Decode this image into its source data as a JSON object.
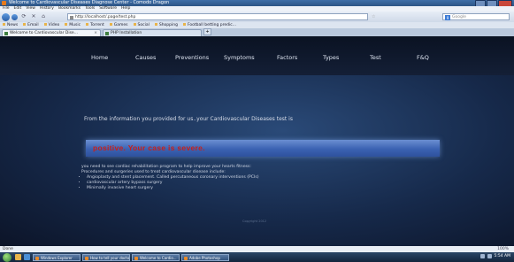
{
  "window": {
    "title": "Welcome to Cardiovascular Diseases Diagnose Center - Comodo Dragon"
  },
  "menubar": [
    "File",
    "Edit",
    "View",
    "History",
    "Bookmarks",
    "Tools",
    "Software",
    "Help"
  ],
  "address": {
    "url": "http://localhost/.page/test.php",
    "search_placeholder": "Google"
  },
  "bookmarks": [
    "News",
    "Email",
    "Video",
    "Music",
    "Torrent",
    "Games",
    "Social",
    "Shopping",
    "Football betting predic..."
  ],
  "tabs": [
    {
      "label": "Welcome to Cardiovascular Dise..."
    },
    {
      "label": "PHP Installation"
    }
  ],
  "site": {
    "nav": [
      "Home",
      "Causes",
      "Preventions",
      "Symptoms",
      "Factors",
      "Types",
      "Test",
      "F&Q"
    ],
    "lead": "From the information you provided for us..your Cardiovascular Diseases test is",
    "result": "positive. Your case is severe.",
    "advice_line1": "you need to see cardiac rehabilitation program to help improve your hearts fitness:",
    "advice_line2": "Procedures and surgeries used to treat cardiovascular disease include:",
    "procedures": [
      "Angioplasty and stent placement. Called percutaneous coronary interventions (PCIs)",
      "cardiovascular artery bypass surgery",
      "Minimally invasive heart surgery"
    ],
    "copyright": "Copyright 2012"
  },
  "status": {
    "left": "Done",
    "right": "100%"
  },
  "taskbar": {
    "tasks": [
      "Windows Explorer",
      "How to tell your doctor",
      "Welcome to Cardio...",
      "Adobe Photoshop"
    ],
    "clock": "5:54 AM"
  }
}
